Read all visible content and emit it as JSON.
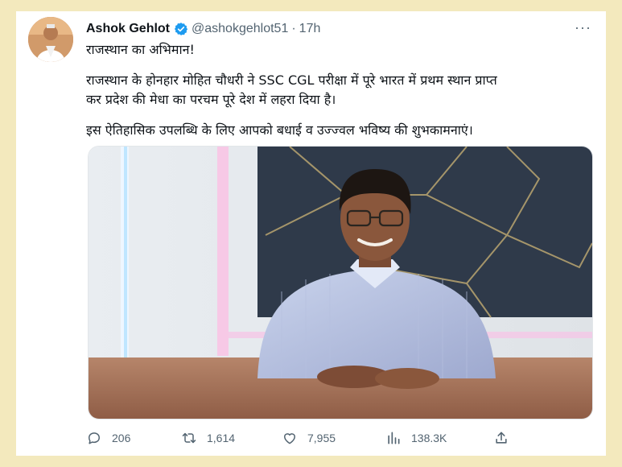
{
  "tweet": {
    "author_name": "Ashok Gehlot",
    "handle": "@ashokgehlot51",
    "time": "17h",
    "separator": "·",
    "more_label": "···",
    "lines": [
      "राजस्थान का अभिमान!",
      "राजस्थान के होनहार मोहित चौधरी ने SSC CGL परीक्षा में पूरे भारत में प्रथम स्थान प्राप्त",
      "कर प्रदेश की मेधा का परचम पूरे देश में लहरा दिया है।",
      "इस ऐतिहासिक उपलब्धि के लिए आपको बधाई व उज्ज्वल भविष्य की शुभकामनाएं।"
    ]
  },
  "actions": {
    "replies": "206",
    "retweets": "1,614",
    "likes": "7,955",
    "views": "138.3K"
  },
  "colors": {
    "frame": "#f3e9bd",
    "text": "#0f1419",
    "muted": "#536471",
    "verified": "#1d9bf0"
  },
  "icons": [
    "more-icon",
    "verified-icon",
    "reply-icon",
    "retweet-icon",
    "like-icon",
    "views-icon",
    "share-icon"
  ]
}
